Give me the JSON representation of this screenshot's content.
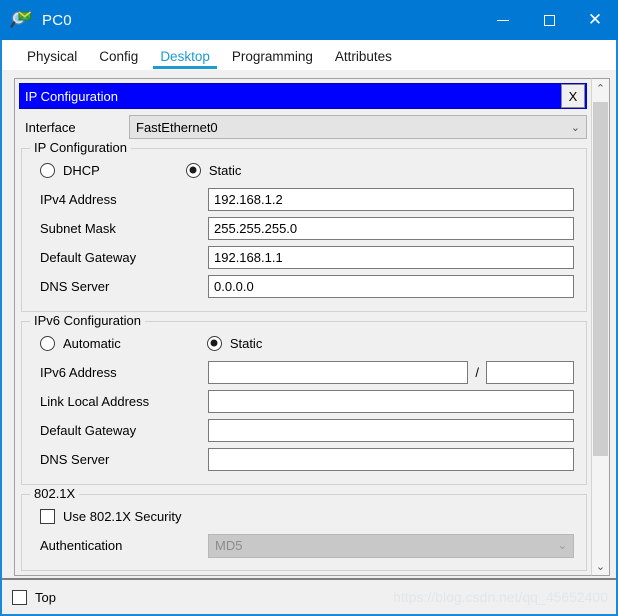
{
  "window": {
    "title": "PC0",
    "icon": "packet-tracer-magnifier-icon",
    "minimize_label": "",
    "maximize_label": "",
    "close_label": "✕",
    "accent_color": "#0078d4"
  },
  "tabs": [
    {
      "label": "Physical",
      "active": false
    },
    {
      "label": "Config",
      "active": false
    },
    {
      "label": "Desktop",
      "active": true
    },
    {
      "label": "Programming",
      "active": false
    },
    {
      "label": "Attributes",
      "active": false
    }
  ],
  "dialog": {
    "header_title": "IP Configuration",
    "header_color": "#0000ff",
    "close_button_label": "X"
  },
  "interface": {
    "label": "Interface",
    "value": "FastEthernet0",
    "chevron": "⌄"
  },
  "ipv4": {
    "group_title": "IP Configuration",
    "mode_dhcp_label": "DHCP",
    "mode_static_label": "Static",
    "selected_mode": "Static",
    "fields": [
      {
        "label": "IPv4 Address",
        "value": "192.168.1.2"
      },
      {
        "label": "Subnet Mask",
        "value": "255.255.255.0"
      },
      {
        "label": "Default Gateway",
        "value": "192.168.1.1"
      },
      {
        "label": "DNS Server",
        "value": "0.0.0.0"
      }
    ]
  },
  "ipv6": {
    "group_title": "IPv6 Configuration",
    "mode_automatic_label": "Automatic",
    "mode_static_label": "Static",
    "selected_mode": "Static",
    "address_label": "IPv6 Address",
    "address_value": "",
    "prefix_separator": "/",
    "prefix_value": "",
    "fields": [
      {
        "label": "Link Local Address",
        "value": ""
      },
      {
        "label": "Default Gateway",
        "value": ""
      },
      {
        "label": "DNS Server",
        "value": ""
      }
    ]
  },
  "dot1x": {
    "group_title": "802.1X",
    "use_security_label": "Use 802.1X Security",
    "use_security_checked": false,
    "authentication_label": "Authentication",
    "authentication_value": "MD5",
    "authentication_disabled": true,
    "chevron": "⌄"
  },
  "scrollbar": {
    "up_arrow": "⌃",
    "down_arrow": "⌄"
  },
  "bottom": {
    "top_checkbox_label": "Top",
    "top_checked": false,
    "watermark": "https://blog.csdn.net/qq_45652400"
  }
}
